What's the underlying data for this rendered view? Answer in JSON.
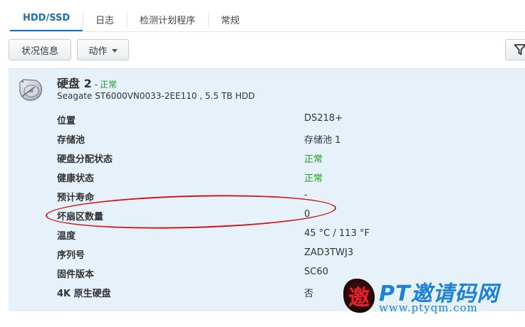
{
  "tabs": [
    {
      "label": "HDD/SSD",
      "active": true
    },
    {
      "label": "日志",
      "active": false
    },
    {
      "label": "检测计划程序",
      "active": false
    },
    {
      "label": "常规",
      "active": false
    }
  ],
  "toolbar": {
    "status_label": "状况信息",
    "action_label": "动作",
    "filter_icon": "filter-icon"
  },
  "disk": {
    "name": "硬盘 2",
    "separator": "-",
    "state": "正常",
    "model": "Seagate ST6000VN0033-2EE110 , 5.5 TB HDD",
    "icon": "disk-icon"
  },
  "details": [
    {
      "label": "位置",
      "value": "DS218+",
      "status": false
    },
    {
      "label": "存储池",
      "value": "存储池 1",
      "status": false
    },
    {
      "label": "硬盘分配状态",
      "value": "正常",
      "status": true
    },
    {
      "label": "健康状态",
      "value": "正常",
      "status": true
    },
    {
      "label": "预计寿命",
      "value": "-",
      "status": false
    },
    {
      "label": "坏扇区数量",
      "value": "0",
      "status": false
    },
    {
      "label": "温度",
      "value": "45 °C / 113 °F",
      "status": false
    },
    {
      "label": "序列号",
      "value": "ZAD3TWJ3",
      "status": false
    },
    {
      "label": "固件版本",
      "value": "SC60",
      "status": false
    },
    {
      "label": "4K 原生硬盘",
      "value": "否",
      "status": false
    }
  ],
  "watermark": {
    "seal_char": "邀",
    "text": "PT邀请码网",
    "url": "www.ptyqm.com"
  },
  "colors": {
    "accent": "#1a6fb5",
    "ok": "#1f9e1f",
    "panel": "#e6f1fa",
    "annotation": "#cc1a1a"
  }
}
